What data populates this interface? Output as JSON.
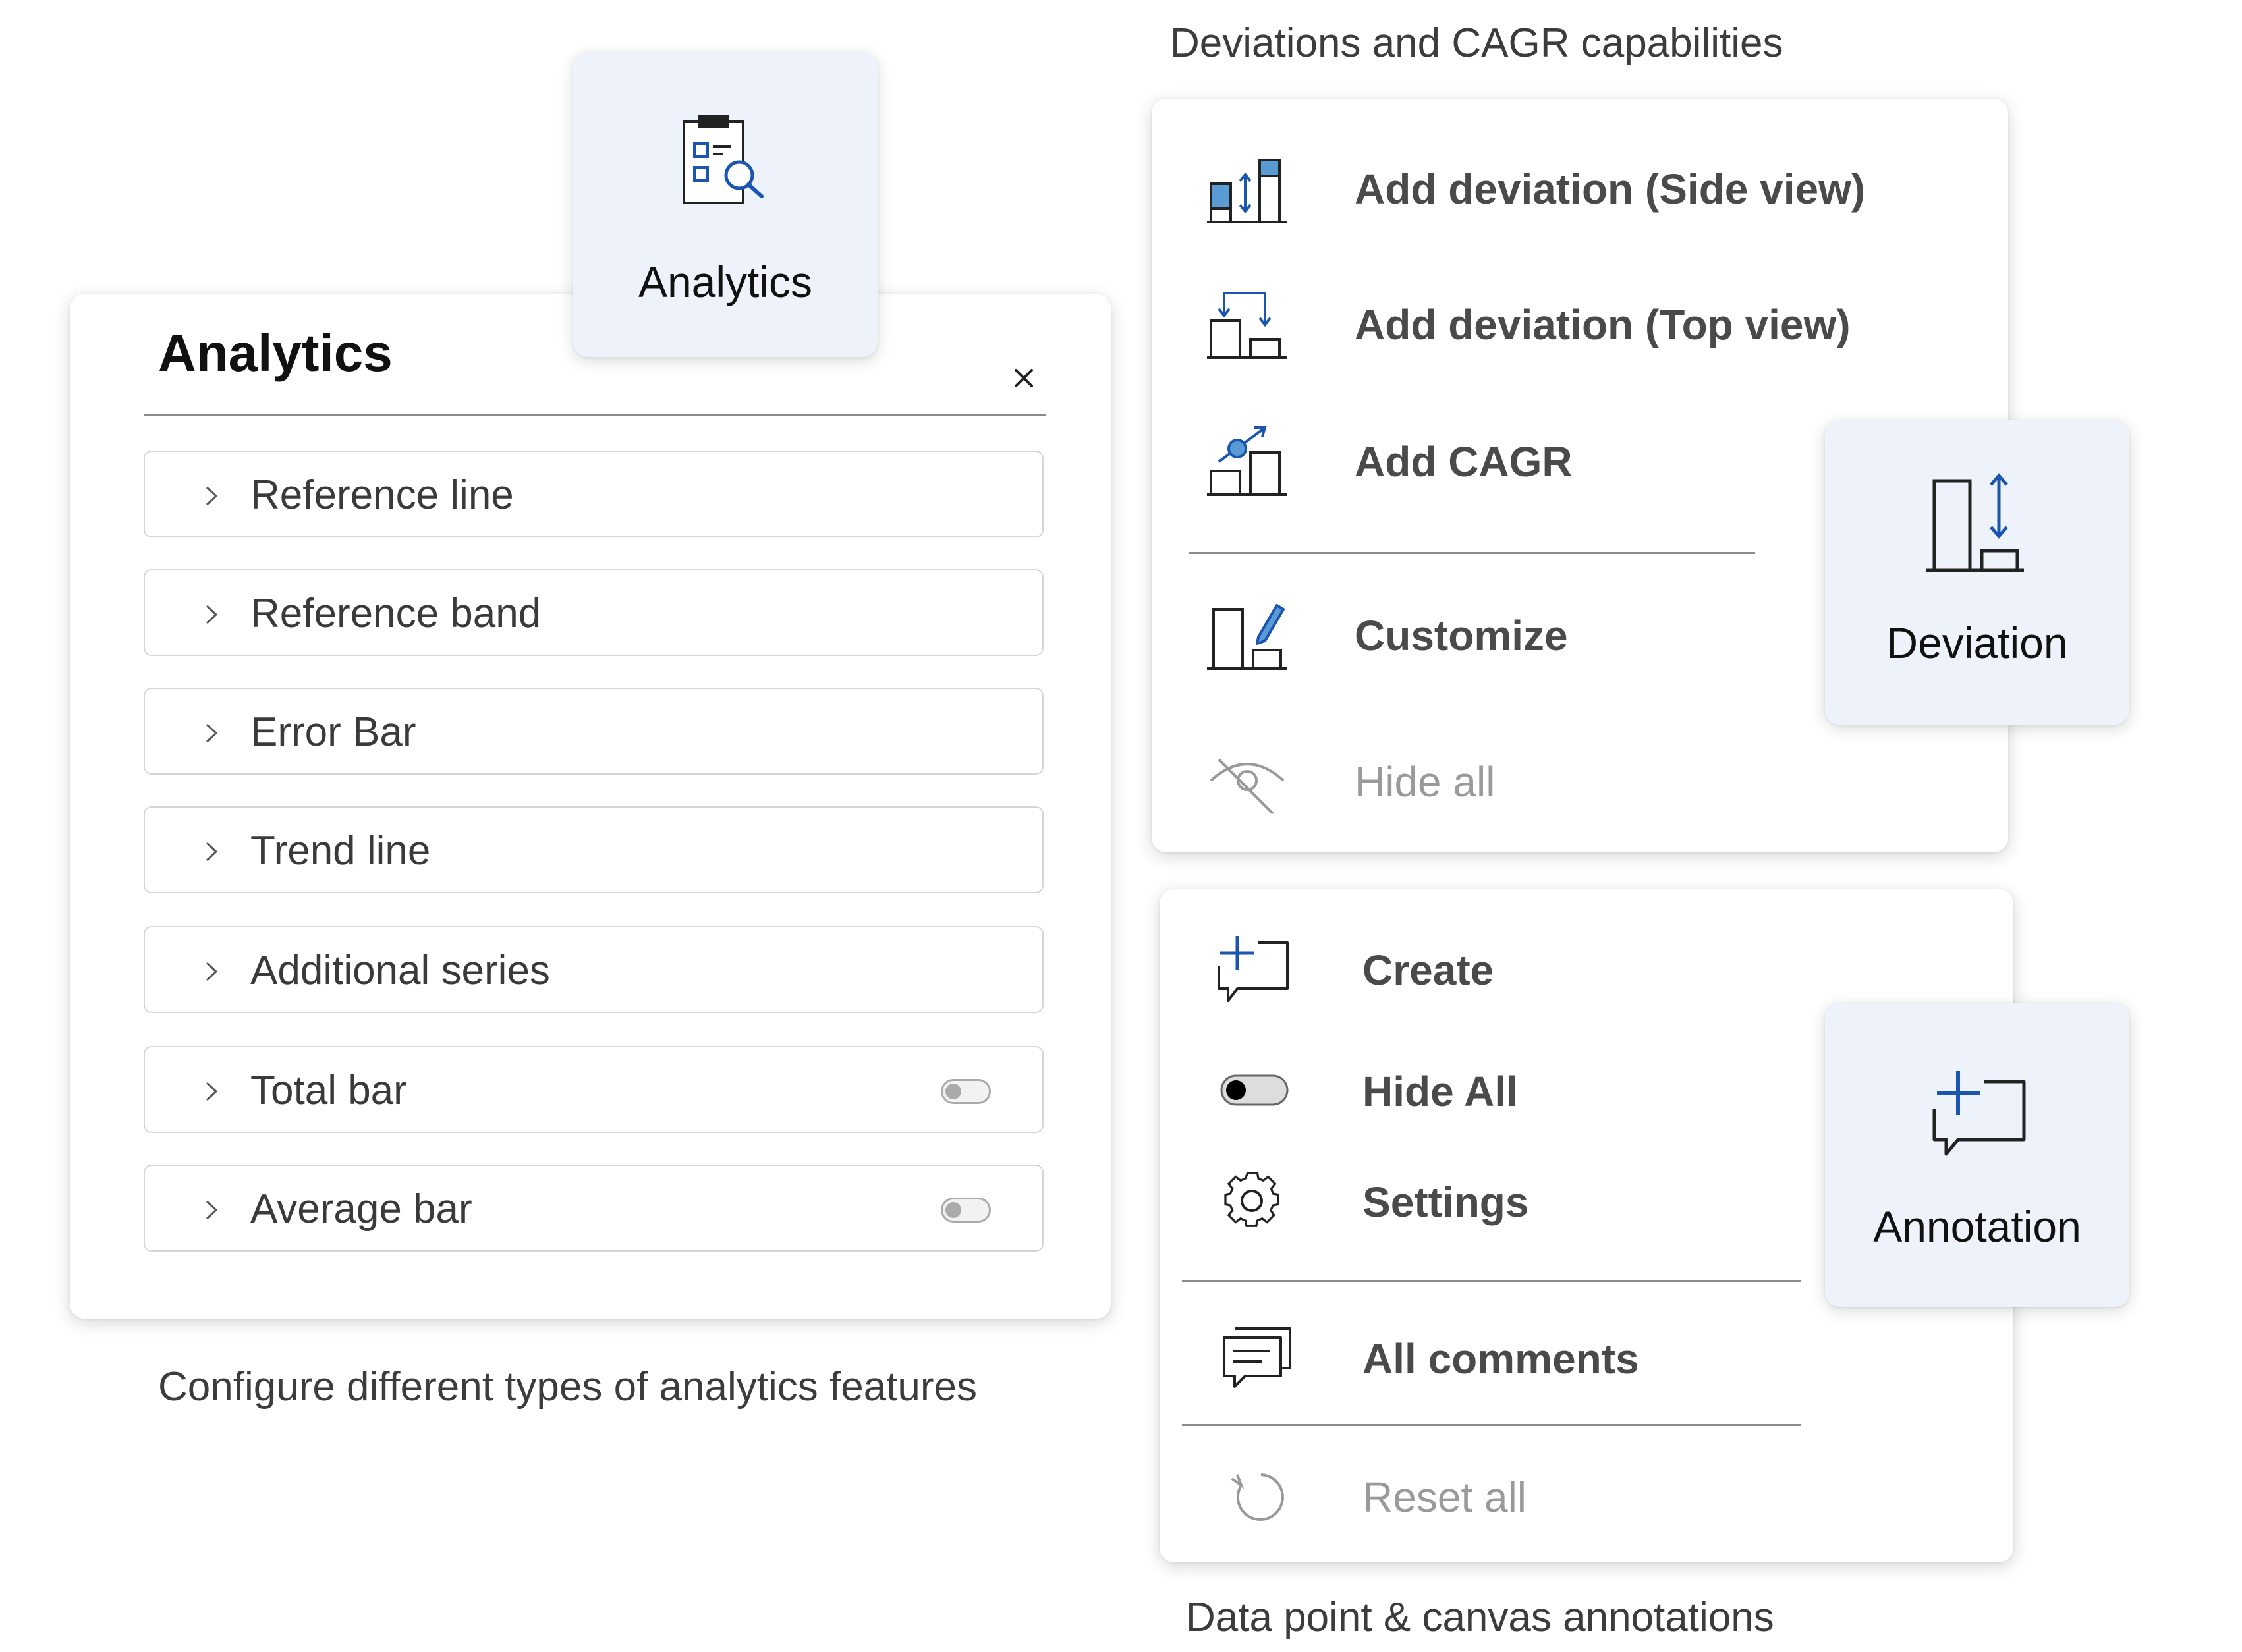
{
  "captions": {
    "deviations": "Deviations and CAGR capabilities",
    "analytics": "Configure different types of analytics features",
    "annotations": "Data point & canvas annotations"
  },
  "analytics_tile": {
    "label": "Analytics",
    "icon": "clipboard-search-icon"
  },
  "analytics_panel": {
    "title": "Analytics",
    "close_icon": "close-icon",
    "rows": [
      {
        "label": "Reference line",
        "has_toggle": false
      },
      {
        "label": "Reference band",
        "has_toggle": false
      },
      {
        "label": "Error Bar",
        "has_toggle": false
      },
      {
        "label": "Trend line",
        "has_toggle": false
      },
      {
        "label": "Additional series",
        "has_toggle": false
      },
      {
        "label": "Total bar",
        "has_toggle": true,
        "toggle_on": false
      },
      {
        "label": "Average bar",
        "has_toggle": true,
        "toggle_on": false
      }
    ]
  },
  "deviation_menu": {
    "items": [
      {
        "label": "Add deviation (Side view)",
        "icon": "deviation-side-view-icon",
        "enabled": true
      },
      {
        "label": "Add deviation (Top view)",
        "icon": "deviation-top-view-icon",
        "enabled": true
      },
      {
        "label": "Add CAGR",
        "icon": "cagr-icon",
        "enabled": true
      },
      {
        "label": "Customize",
        "icon": "customize-chart-icon",
        "enabled": true
      },
      {
        "label": "Hide all",
        "icon": "eye-off-icon",
        "enabled": false
      }
    ]
  },
  "deviation_tile": {
    "label": "Deviation",
    "icon": "deviation-icon"
  },
  "annotation_menu": {
    "items": [
      {
        "label": "Create",
        "icon": "add-comment-icon",
        "enabled": true
      },
      {
        "label": "Hide All",
        "icon": "toggle-icon",
        "enabled": true,
        "toggle_on": false
      },
      {
        "label": "Settings",
        "icon": "gear-icon",
        "enabled": true
      },
      {
        "label": "All comments",
        "icon": "comments-icon",
        "enabled": true
      },
      {
        "label": "Reset all",
        "icon": "reset-icon",
        "enabled": false
      }
    ]
  },
  "annotation_tile": {
    "label": "Annotation",
    "icon": "add-comment-icon"
  },
  "colors": {
    "accent_blue": "#1a56b0",
    "icon_fill_blue": "#5b9bd5",
    "tile_bg": "#eef2fb",
    "disabled_text": "#9a9a9a"
  }
}
